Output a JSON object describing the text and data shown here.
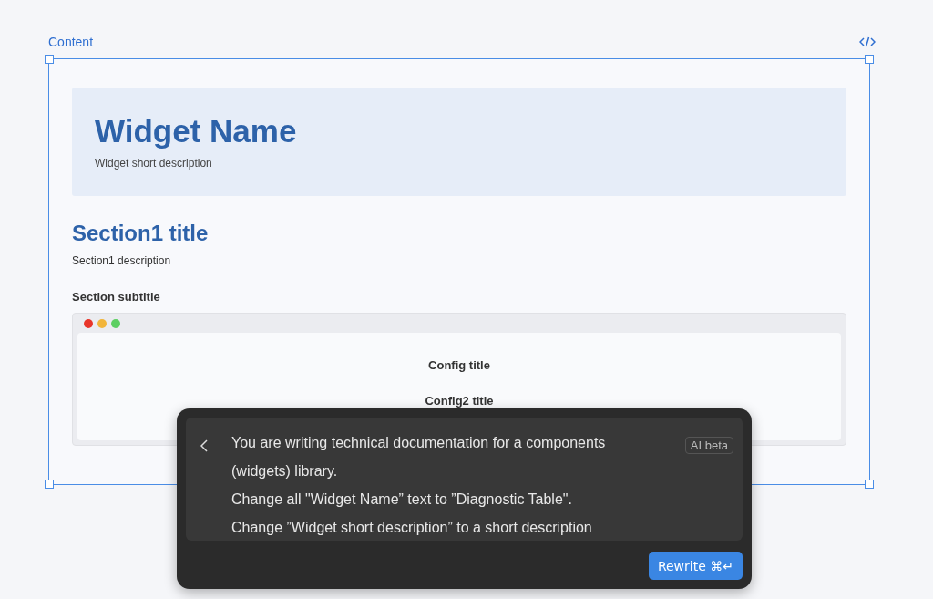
{
  "frame": {
    "label": "Content"
  },
  "header": {
    "title": "Widget  Name",
    "description": "Widget short description"
  },
  "section": {
    "title": "Section1 title",
    "description": "Section1 description",
    "subtitle": "Section subtitle"
  },
  "preview": {
    "items": [
      "Config title",
      "Config2 title"
    ]
  },
  "prompt": {
    "lines": [
      "You are writing technical documentation for a components",
      "(widgets) library.",
      "Change all \"Widget Name” text to ”Diagnostic Table\".",
      "Change ”Widget short description” to a short description"
    ],
    "badge": "AI beta",
    "button": "Rewrite ⌘↵"
  }
}
